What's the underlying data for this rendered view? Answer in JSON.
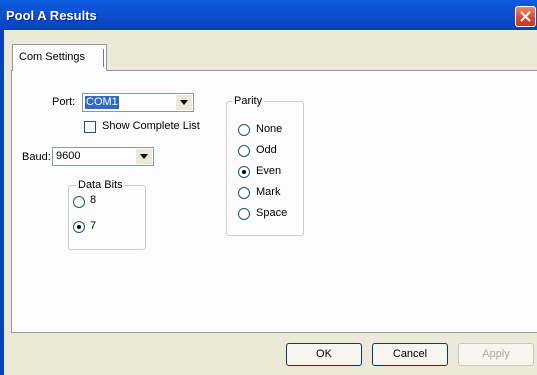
{
  "window": {
    "title": "Pool A Results"
  },
  "tabs": [
    {
      "label": "Com Settings"
    }
  ],
  "port": {
    "label": "Port:",
    "value": "COM1"
  },
  "show_complete_list": {
    "label": "Show Complete List",
    "checked": false
  },
  "baud": {
    "label": "Baud:",
    "value": "9600"
  },
  "data_bits": {
    "legend": "Data Bits",
    "options": [
      {
        "label": "8",
        "selected": false
      },
      {
        "label": "7",
        "selected": true
      }
    ]
  },
  "parity": {
    "legend": "Parity",
    "options": [
      {
        "label": "None",
        "selected": false
      },
      {
        "label": "Odd",
        "selected": false
      },
      {
        "label": "Even",
        "selected": true
      },
      {
        "label": "Mark",
        "selected": false
      },
      {
        "label": "Space",
        "selected": false
      }
    ]
  },
  "buttons": {
    "ok": "OK",
    "cancel": "Cancel",
    "apply": "Apply"
  }
}
